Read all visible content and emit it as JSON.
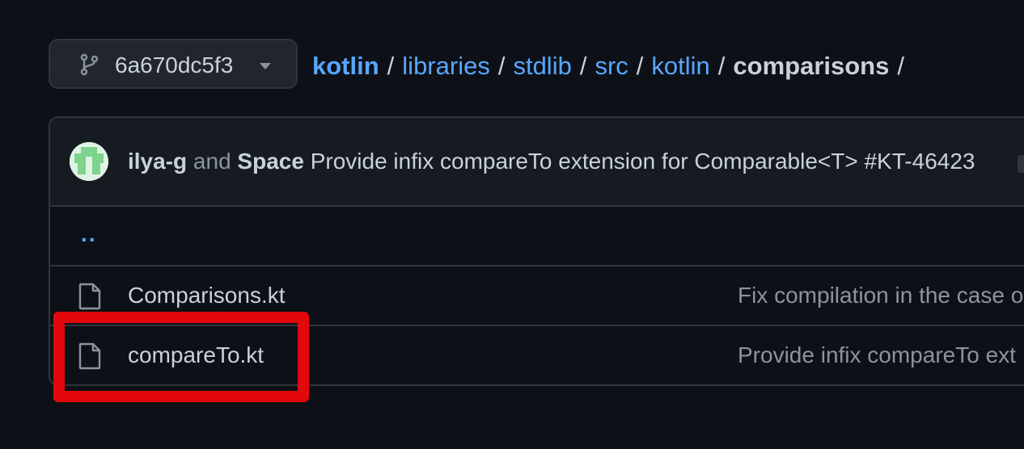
{
  "branch": {
    "name": "6a670dc5f3",
    "icon": "git-branch-icon"
  },
  "breadcrumb": {
    "items": [
      "kotlin",
      "libraries",
      "stdlib",
      "src",
      "kotlin"
    ],
    "current": "comparisons",
    "separator": "/"
  },
  "commit": {
    "author1": "ilya-g",
    "and_text": "and",
    "author2": "Space",
    "message": "Provide infix compareTo extension for Comparable<T> #KT-46423"
  },
  "files": {
    "up_link": "..",
    "rows": [
      {
        "name": "Comparisons.kt",
        "message": "Fix compilation in the case o"
      },
      {
        "name": "compareTo.kt",
        "message": "Provide infix compareTo ext"
      }
    ]
  },
  "colors": {
    "link": "#58a6ff",
    "highlight": "#e3080c",
    "background": "#0d1117"
  }
}
